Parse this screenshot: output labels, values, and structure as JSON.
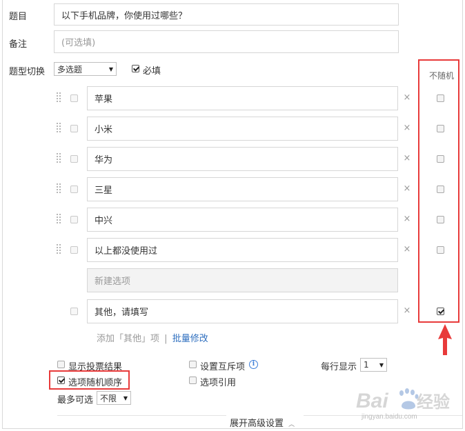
{
  "form": {
    "title_label": "题目",
    "title_value": "以下手机品牌，你使用过哪些？",
    "note_label": "备注",
    "note_placeholder": "(可选填)",
    "type_label": "题型切换",
    "type_select": "多选题",
    "required_label": "必填",
    "required_checked": true,
    "no_random_header": "不随机"
  },
  "options": [
    {
      "text": "苹果",
      "no_random": false
    },
    {
      "text": "小米",
      "no_random": false
    },
    {
      "text": "华为",
      "no_random": false
    },
    {
      "text": "三星",
      "no_random": false
    },
    {
      "text": "中兴",
      "no_random": false
    },
    {
      "text": "以上都没使用过",
      "no_random": false
    }
  ],
  "new_option_placeholder": "新建选项",
  "other_option": {
    "text": "其他，请填写",
    "no_random": true
  },
  "add_links": {
    "add_other": "添加「其他」项",
    "separator": "|",
    "batch_edit": "批量修改"
  },
  "settings": {
    "show_vote_result": "显示投票结果",
    "set_mutex": "设置互斥项",
    "per_row_label": "每行显示",
    "per_row_value": "1",
    "random_order": "选项随机顺序",
    "random_order_checked": true,
    "option_reference": "选项引用",
    "max_select_label": "最多可选",
    "max_select_value": "不限"
  },
  "advanced": {
    "label": "展开高级设置",
    "chevron": "chevron-up-icon"
  },
  "watermark": {
    "text": "Baidu经验",
    "url": "jingyan.baidu.com"
  },
  "colors": {
    "highlight_red": "#e83a3a",
    "link_blue": "#2f6fbf",
    "baidu_blue": "#2a6fd6"
  }
}
